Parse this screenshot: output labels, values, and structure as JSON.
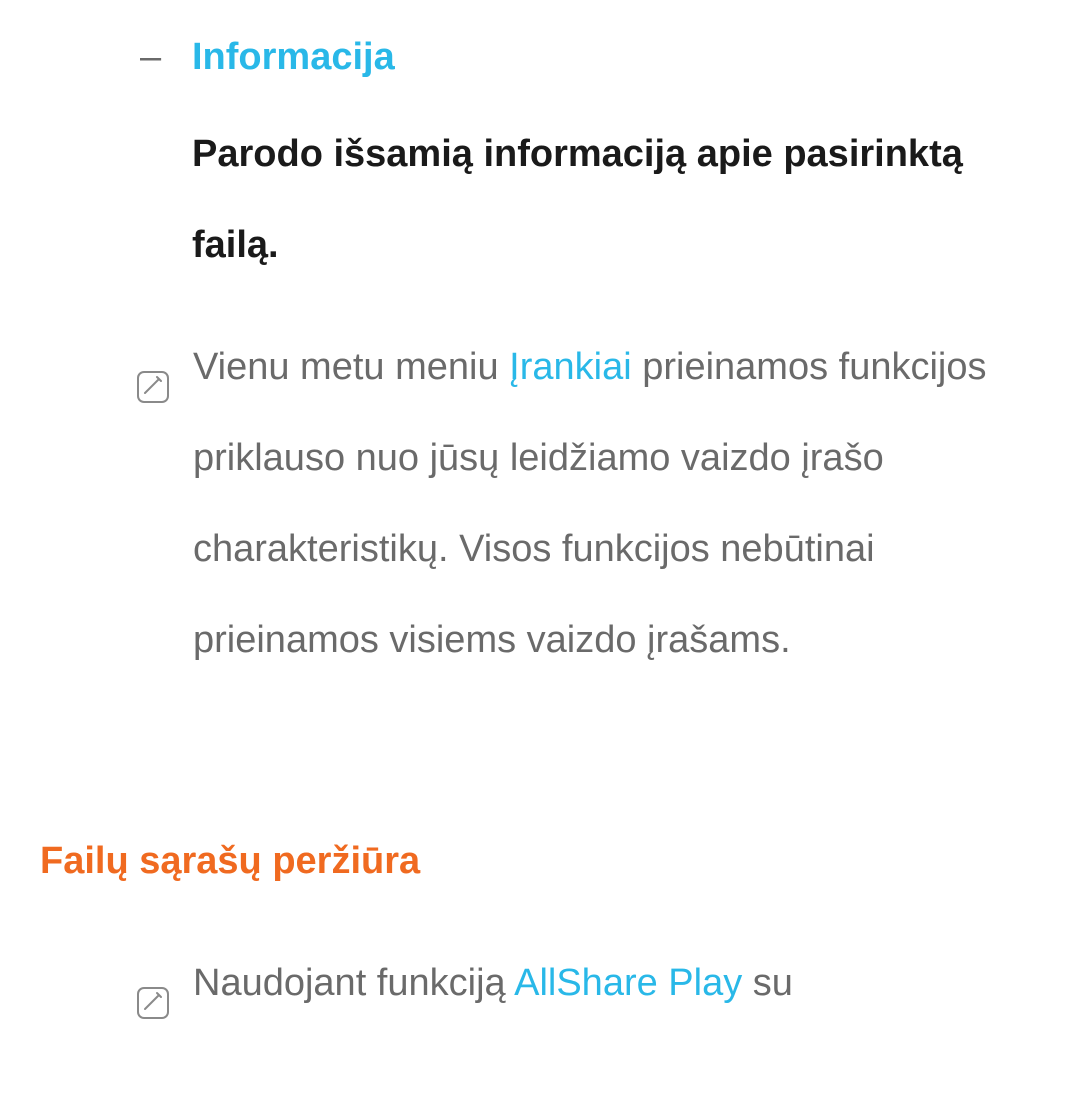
{
  "item": {
    "bullet": "–",
    "title": "Informacija",
    "description": "Parodo išsamią informaciją apie pasirinktą failą."
  },
  "note1": {
    "prefix": "Vienu metu meniu ",
    "highlight": "Įrankiai",
    "suffix": " prieinamos funkcijos priklauso nuo jūsų leidžiamo vaizdo įrašo charakteristikų. Visos funkcijos nebūtinai prieinamos visiems vaizdo įrašams."
  },
  "section": {
    "heading": "Failų sąrašų peržiūra"
  },
  "note2": {
    "prefix": "Naudojant funkciją ",
    "highlight": "AllShare Play",
    "suffix": " su"
  }
}
